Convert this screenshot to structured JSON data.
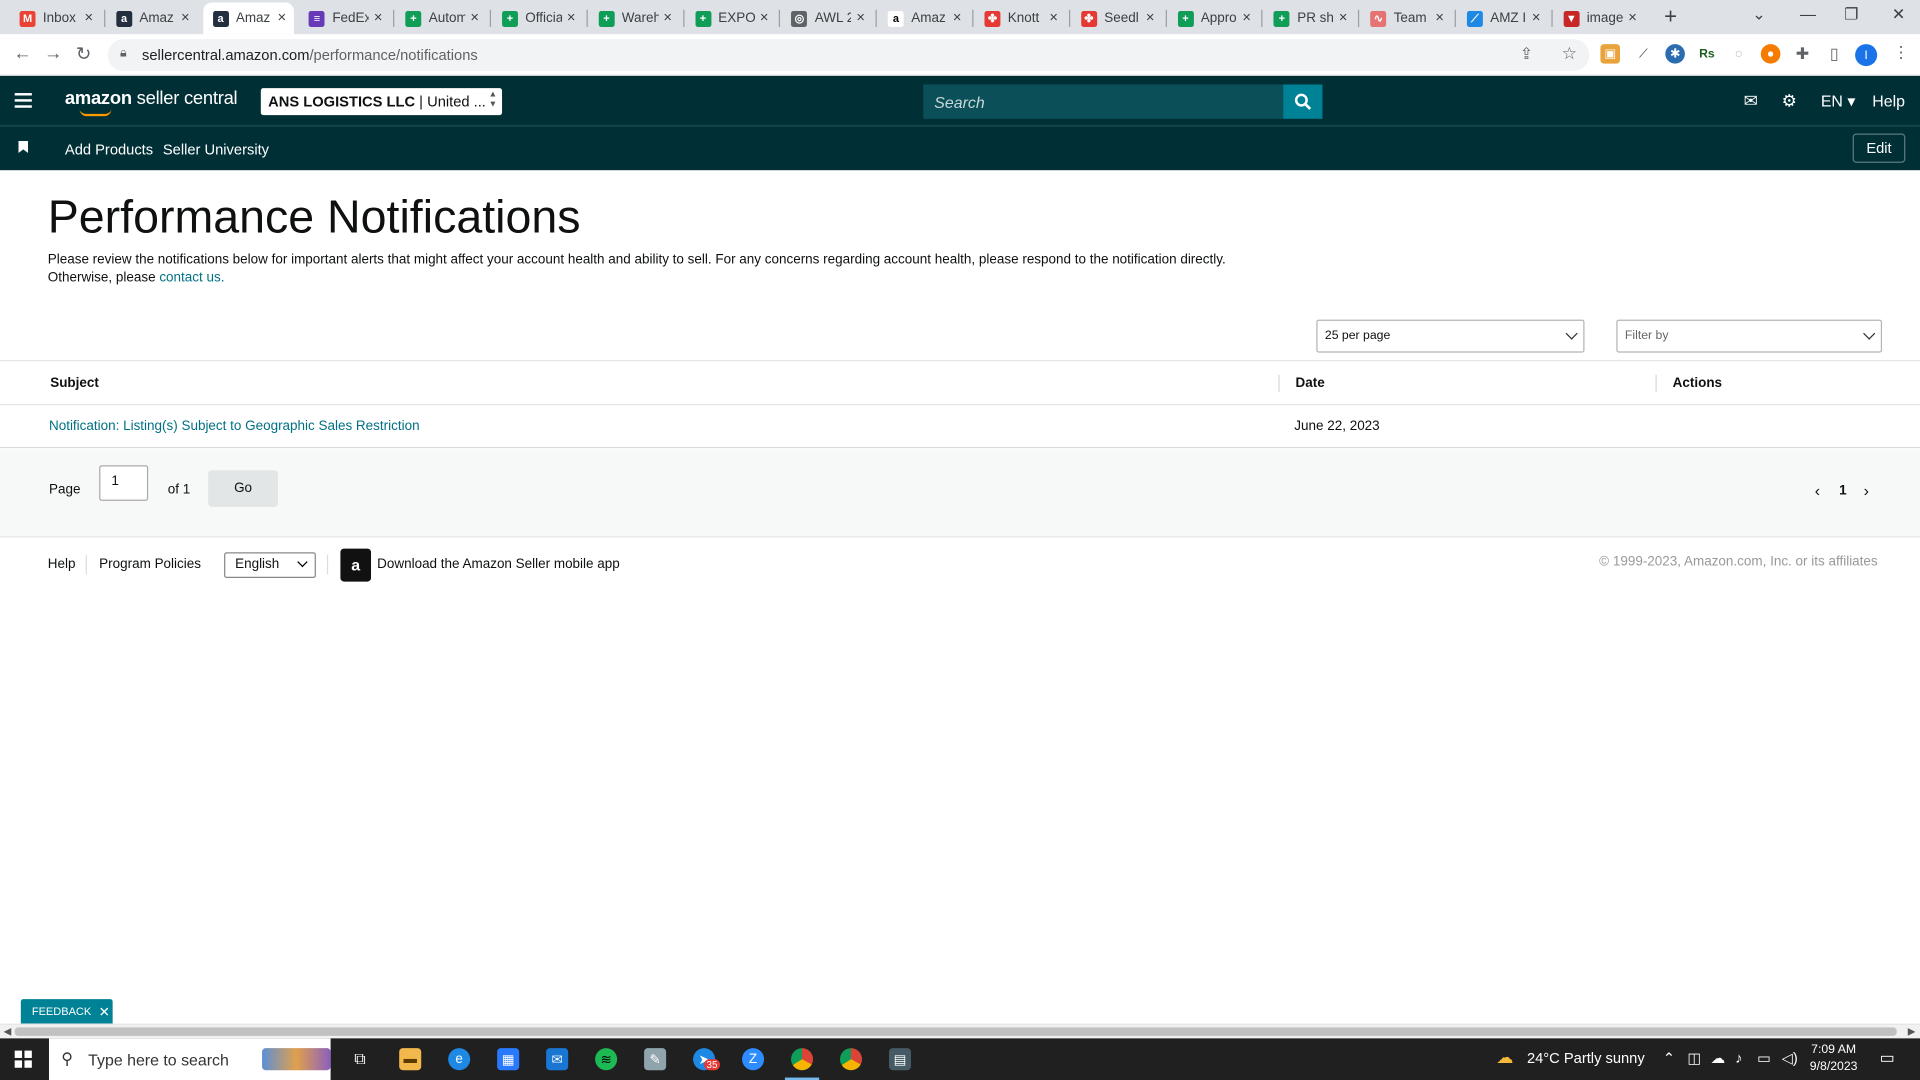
{
  "browser": {
    "tabs": [
      {
        "label": "Inbox",
        "favicon": "gmail-icon",
        "color": "#ea4335",
        "glyph": "M"
      },
      {
        "label": "Amaz",
        "favicon": "amazon-icon",
        "color": "#232f3e",
        "glyph": "a"
      },
      {
        "label": "Amaz",
        "favicon": "amazon-icon",
        "color": "#232f3e",
        "glyph": "a",
        "active": true
      },
      {
        "label": "FedEx",
        "favicon": "forms-icon",
        "color": "#673ab7",
        "glyph": "≡"
      },
      {
        "label": "Autom",
        "favicon": "sheets-icon",
        "color": "#0f9d58",
        "glyph": "+"
      },
      {
        "label": "Officia",
        "favicon": "sheets-icon",
        "color": "#0f9d58",
        "glyph": "+"
      },
      {
        "label": "Wareh",
        "favicon": "sheets-icon",
        "color": "#0f9d58",
        "glyph": "+"
      },
      {
        "label": "EXPOR",
        "favicon": "sheets-icon",
        "color": "#0f9d58",
        "glyph": "+"
      },
      {
        "label": "AWL 2",
        "favicon": "globe-icon",
        "color": "#5f6368",
        "glyph": "◎"
      },
      {
        "label": "Amaz",
        "favicon": "amazon-smile-icon",
        "color": "#ffffff",
        "glyph": "a"
      },
      {
        "label": "Knott",
        "favicon": "knotty-icon",
        "color": "#e53935",
        "glyph": "✤"
      },
      {
        "label": "Seedl",
        "favicon": "seedling-icon",
        "color": "#e53935",
        "glyph": "✤"
      },
      {
        "label": "Appro",
        "favicon": "sheets-icon",
        "color": "#0f9d58",
        "glyph": "+"
      },
      {
        "label": "PR sh",
        "favicon": "sheets-icon",
        "color": "#0f9d58",
        "glyph": "+"
      },
      {
        "label": "Team",
        "favicon": "team-icon",
        "color": "#e57373",
        "glyph": "∿"
      },
      {
        "label": "AMZ I",
        "favicon": "amz-icon",
        "color": "#1e88e5",
        "glyph": "⟋"
      },
      {
        "label": "image",
        "favicon": "image-icon",
        "color": "#c62828",
        "glyph": "▼"
      }
    ],
    "url_host": "sellercentral.amazon.com",
    "url_path": "/performance/notifications",
    "profile_initial": "I"
  },
  "header": {
    "logo_bold": "amazon",
    "logo_rest": " seller central",
    "account_bold": "ANS LOGISTICS LLC",
    "account_rest": " | United ...",
    "search_placeholder": "Search",
    "lang": "EN",
    "help": "Help"
  },
  "subnav": {
    "items": [
      "Add Products",
      "Seller University"
    ],
    "edit": "Edit"
  },
  "main": {
    "title": "Performance Notifications",
    "description": "Please review the notifications below for important alerts that might affect your account health and ability to sell. For any concerns regarding account health, please respond to the notification directly. Otherwise, please ",
    "contact_link": "contact us.",
    "per_page": "25 per page",
    "filter_placeholder": "Filter by",
    "columns": [
      "Subject",
      "Date",
      "Actions"
    ],
    "rows": [
      {
        "subject": "Notification: Listing(s) Subject to Geographic Sales Restriction",
        "date": "June 22, 2023",
        "actions": ""
      }
    ],
    "pager": {
      "page_label": "Page",
      "page_value": "1",
      "of_label": "of 1",
      "go": "Go",
      "current": "1"
    }
  },
  "footer": {
    "help": "Help",
    "policies": "Program Policies",
    "language": "English",
    "app_text": "Download the Amazon Seller mobile app",
    "copyright": "© 1999-2023, Amazon.com, Inc. or its affiliates"
  },
  "feedback": "FEEDBACK",
  "taskbar": {
    "search_placeholder": "Type here to search",
    "weather": "24°C  Partly sunny",
    "time": "7:09 AM",
    "date": "9/8/2023",
    "badge": "35"
  }
}
